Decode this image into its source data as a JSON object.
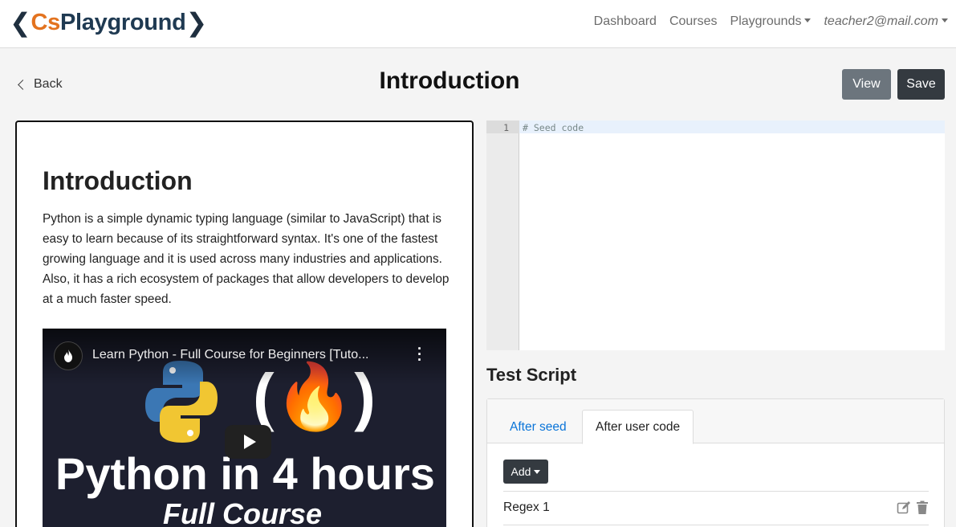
{
  "brand": {
    "prefix": "Cs",
    "name": "Playground"
  },
  "nav": {
    "dashboard": "Dashboard",
    "courses": "Courses",
    "playgrounds": "Playgrounds",
    "user": "teacher2@mail.com"
  },
  "header": {
    "back_label": "Back",
    "title": "Introduction",
    "view_label": "View",
    "save_label": "Save"
  },
  "content": {
    "heading": "Introduction",
    "paragraph": "Python is a simple dynamic typing language (similar to JavaScript) that is easy to learn because of its straightforward syntax. It's one of the fastest growing language and it is used across many industries and applications. Also, it has a rich ecosystem of packages that allow developers to develop at a much faster speed.",
    "video": {
      "title": "Learn Python - Full Course for Beginners [Tuto...",
      "thumb_line1": "Python in 4 hours",
      "thumb_line2": "Full Course"
    }
  },
  "editor": {
    "line_number": "1",
    "code": "# Seed code"
  },
  "test_script": {
    "title": "Test Script",
    "tab_seed": "After seed",
    "tab_user": "After user code",
    "add_label": "Add",
    "rows": [
      {
        "label": "Regex 1"
      }
    ]
  },
  "colors": {
    "accent": "#e3731f",
    "brand_dark": "#1f3a52",
    "link": "#0a74d8",
    "btn_view": "#6c757d",
    "btn_dark": "#343a40"
  }
}
